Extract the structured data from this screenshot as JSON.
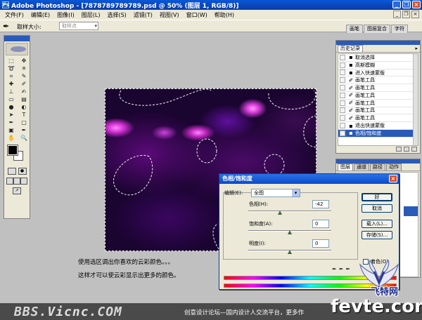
{
  "window": {
    "title": "Adobe Photoshop - [7878789789789.psd @ 50% (图层 1, RGB/8)]",
    "icon": "photoshop-icon"
  },
  "menu": [
    "文件(F)",
    "编辑(E)",
    "图像(I)",
    "图层(L)",
    "选择(S)",
    "滤镜(T)",
    "视图(V)",
    "窗口(W)",
    "帮助(H)"
  ],
  "options_bar": {
    "tool_icon": "eyedropper-icon",
    "label": "取样大小:",
    "value": "取样点",
    "tabs": [
      "画笔",
      "图层复合",
      "字符"
    ]
  },
  "history_panel": {
    "tab": "历史记录",
    "items": [
      {
        "label": "取消选择",
        "icon": "history-step-icon"
      },
      {
        "label": "高斯模糊",
        "icon": "history-step-icon"
      },
      {
        "label": "进入快速蒙版",
        "icon": "history-step-icon"
      },
      {
        "label": "画笔工具",
        "icon": "brush-icon"
      },
      {
        "label": "画笔工具",
        "icon": "brush-icon"
      },
      {
        "label": "画笔工具",
        "icon": "brush-icon"
      },
      {
        "label": "画笔工具",
        "icon": "brush-icon"
      },
      {
        "label": "画笔工具",
        "icon": "brush-icon"
      },
      {
        "label": "画笔工具",
        "icon": "brush-icon"
      },
      {
        "label": "退出快速蒙版",
        "icon": "history-step-icon"
      },
      {
        "label": "色相/饱和度",
        "icon": "history-step-icon",
        "active": true
      }
    ]
  },
  "layers_panel": {
    "tabs": [
      "图层",
      "通道",
      "路径",
      "动作"
    ]
  },
  "dialog": {
    "title": "色相/饱和度",
    "edit_label": "编辑(E):",
    "edit_value": "全图",
    "hue": {
      "label": "色相(H):",
      "value": "-42",
      "level": -42
    },
    "saturation": {
      "label": "饱和度(A):",
      "value": "0",
      "level": 0
    },
    "lightness": {
      "label": "明度(I):",
      "value": "0",
      "level": 0
    },
    "buttons": {
      "ok": "好",
      "cancel": "取消",
      "load": "载入(L)...",
      "save": "存储(S)..."
    },
    "colorize": "着色(O)"
  },
  "captions": [
    "使用选区调出你喜欢的云彩颜色。。。",
    "这样才可以使云彩显示出更多的颜色。"
  ],
  "footer": {
    "logo_prefix": "BBS.",
    "logo_mid": "Vicnc",
    "logo_suffix": ".COM",
    "slogan": "创意设计论坛—国内设计人交流平台，更多作"
  },
  "watermark": {
    "cn": "飞特网",
    "en": "fevte.com"
  },
  "colors": {
    "foreground": "#000000",
    "background": "#ffffff",
    "accent": "#2a5ab8"
  }
}
